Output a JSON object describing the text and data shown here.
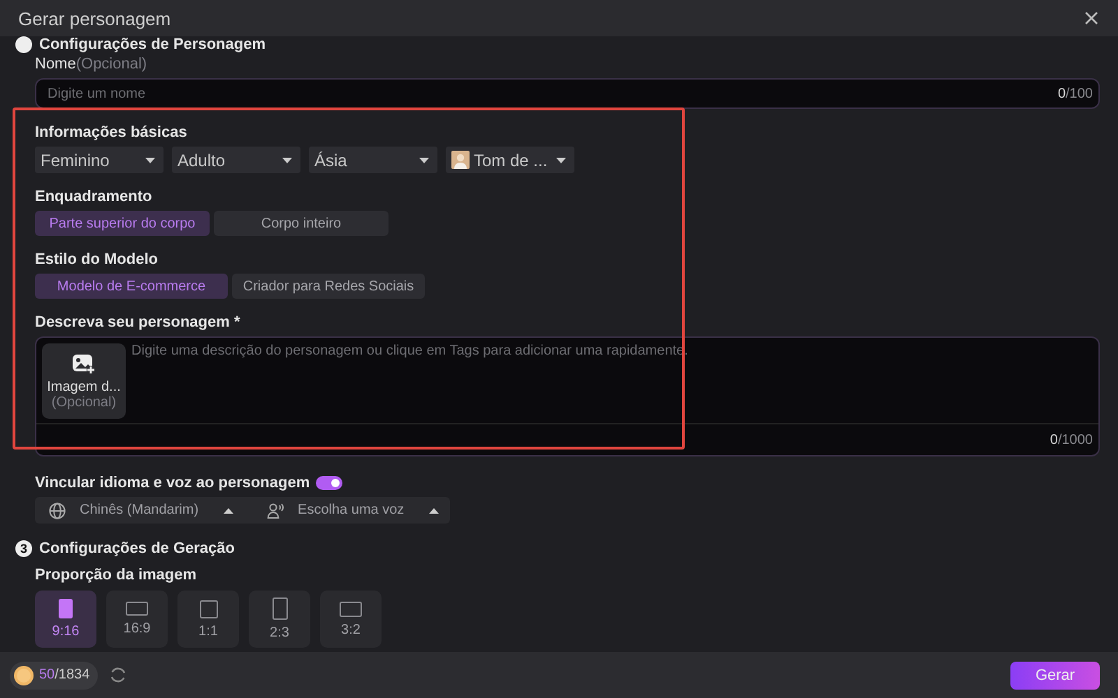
{
  "window": {
    "title": "Gerar personagem"
  },
  "character_section": {
    "heading": "Configurações de Personagem",
    "name": {
      "label": "Nome",
      "hint": "(Opcional)",
      "placeholder": "Digite um nome",
      "count": "0",
      "max": "/100"
    },
    "basic_info": {
      "label": "Informações básicas",
      "dropdowns": [
        {
          "value": "Feminino",
          "kind": "plain"
        },
        {
          "value": "Adulto",
          "kind": "plain"
        },
        {
          "value": "Ásia",
          "kind": "plain"
        },
        {
          "value": "Tom de ...",
          "kind": "swatch"
        }
      ]
    },
    "framing": {
      "label": "Enquadramento",
      "options": [
        {
          "label": "Parte superior do corpo",
          "selected": true
        },
        {
          "label": "Corpo inteiro",
          "selected": false
        }
      ]
    },
    "model_style": {
      "label": "Estilo do Modelo",
      "options": [
        {
          "label": "Modelo de E-commerce",
          "selected": true
        },
        {
          "label": "Criador para Redes Sociais",
          "selected": false
        }
      ]
    },
    "description": {
      "label": "Descreva seu personagem *",
      "placeholder": "Digite uma descrição do personagem ou clique em Tags para adicionar uma rapidamente.",
      "image_upload": {
        "label": "Imagem d...",
        "hint": "(Opcional)"
      },
      "count": "0",
      "max": "/1000"
    },
    "voice_link": {
      "label": "Vincular idioma e voz ao personagem",
      "on": true,
      "language": "Chinês (Mandarim)",
      "voice": "Escolha uma voz"
    }
  },
  "generation_section": {
    "step": "3",
    "heading": "Configurações de Geração",
    "aspect": {
      "label": "Proporção da imagem",
      "options": [
        {
          "label": "9:16",
          "kind": "tall",
          "selected": true
        },
        {
          "label": "16:9",
          "kind": "wide",
          "selected": false
        },
        {
          "label": "1:1",
          "kind": "square",
          "selected": false
        },
        {
          "label": "2:3",
          "kind": "portrait",
          "selected": false
        },
        {
          "label": "3:2",
          "kind": "landscape",
          "selected": false
        }
      ]
    }
  },
  "footer": {
    "credits_used": "50",
    "credits_total": "/1834",
    "button": "Gerar"
  }
}
